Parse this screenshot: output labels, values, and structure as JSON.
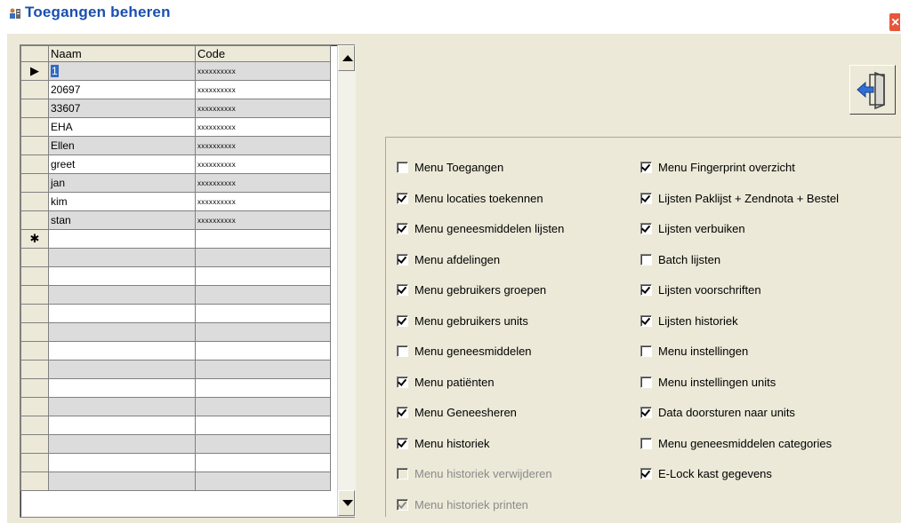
{
  "window": {
    "title": "Toegangen beheren",
    "close_glyph": "×",
    "icon": "users-icon",
    "exit_icon": "exit-door-icon"
  },
  "grid": {
    "headers": [
      "Naam",
      "Code"
    ],
    "rows": [
      {
        "indicator": "▶",
        "naam": "1",
        "code": "xxxxxxxxxx"
      },
      {
        "indicator": "",
        "naam": "20697",
        "code": "xxxxxxxxxx"
      },
      {
        "indicator": "",
        "naam": "33607",
        "code": "xxxxxxxxxx"
      },
      {
        "indicator": "",
        "naam": "EHA",
        "code": "xxxxxxxxxx"
      },
      {
        "indicator": "",
        "naam": "Ellen",
        "code": "xxxxxxxxxx"
      },
      {
        "indicator": "",
        "naam": "greet",
        "code": "xxxxxxxxxx"
      },
      {
        "indicator": "",
        "naam": "jan",
        "code": "xxxxxxxxxx"
      },
      {
        "indicator": "",
        "naam": "kim",
        "code": "xxxxxxxxxx"
      },
      {
        "indicator": "",
        "naam": "stan",
        "code": "xxxxxxxxxx"
      },
      {
        "indicator": "✱",
        "naam": "",
        "code": ""
      }
    ],
    "empty_rows": 13
  },
  "permissions": {
    "left": [
      {
        "label": "Menu Toegangen",
        "checked": false,
        "enabled": true
      },
      {
        "label": "Menu locaties toekennen",
        "checked": true,
        "enabled": true
      },
      {
        "label": "Menu geneesmiddelen lijsten",
        "checked": true,
        "enabled": true
      },
      {
        "label": "Menu afdelingen",
        "checked": true,
        "enabled": true
      },
      {
        "label": "Menu gebruikers groepen",
        "checked": true,
        "enabled": true
      },
      {
        "label": "Menu gebruikers units",
        "checked": true,
        "enabled": true
      },
      {
        "label": "Menu geneesmiddelen",
        "checked": false,
        "enabled": true
      },
      {
        "label": "Menu patiënten",
        "checked": true,
        "enabled": true
      },
      {
        "label": "Menu Geneesheren",
        "checked": true,
        "enabled": true
      },
      {
        "label": "Menu historiek",
        "checked": true,
        "enabled": true
      },
      {
        "label": "Menu historiek verwijderen",
        "checked": false,
        "enabled": false
      },
      {
        "label": "Menu historiek printen",
        "checked": true,
        "enabled": false
      }
    ],
    "right": [
      {
        "label": "Menu Fingerprint overzicht",
        "checked": true,
        "enabled": true
      },
      {
        "label": "Lijsten Paklijst + Zendnota + Bestel",
        "checked": true,
        "enabled": true
      },
      {
        "label": "Lijsten verbuiken",
        "checked": true,
        "enabled": true
      },
      {
        "label": "Batch lijsten",
        "checked": false,
        "enabled": true
      },
      {
        "label": "Lijsten voorschriften",
        "checked": true,
        "enabled": true
      },
      {
        "label": "Lijsten historiek",
        "checked": true,
        "enabled": true
      },
      {
        "label": "Menu instellingen",
        "checked": false,
        "enabled": true
      },
      {
        "label": "Menu instellingen units",
        "checked": false,
        "enabled": true
      },
      {
        "label": "Data doorsturen naar units",
        "checked": true,
        "enabled": true
      },
      {
        "label": "Menu geneesmiddelen categories",
        "checked": false,
        "enabled": true
      },
      {
        "label": "E-Lock kast gegevens",
        "checked": true,
        "enabled": true
      }
    ]
  }
}
